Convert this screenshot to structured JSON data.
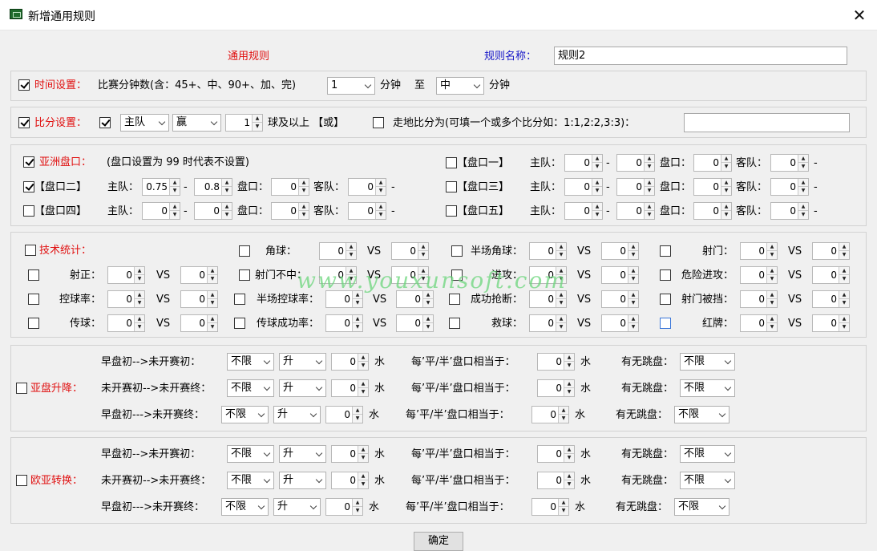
{
  "window": {
    "title": "新增通用规则",
    "close_glyph": "✕"
  },
  "header": {
    "section_label": "通用规则",
    "rule_name_label": "规则名称：",
    "rule_name_value": "规则2"
  },
  "time": {
    "label": "时间设置：",
    "desc": "比赛分钟数(含：45+、中、90+、加、完)",
    "from_value": "1",
    "from_unit": "分钟",
    "to_label": "至",
    "to_value": "中",
    "to_unit": "分钟"
  },
  "score": {
    "label": "比分设置：",
    "team": "主队",
    "result": "赢",
    "goals": "1",
    "goals_suffix": "球及以上 【或】",
    "alt_label": "走地比分为(可填一个或多个比分如：1:1,2:2,3:3)："
  },
  "handicap": {
    "label": "亚洲盘口：",
    "note": "(盘口设置为 99 时代表不设置)",
    "home": "主队：",
    "line": "盘口：",
    "away": "客队：",
    "dash": "-",
    "rows": [
      {
        "name": "【盘口一】",
        "home_from": "0",
        "home_to": "0",
        "line": "0",
        "away_from": "0"
      },
      {
        "name": "【盘口二】",
        "home_from": "0.75",
        "home_to": "0.8",
        "line": "0",
        "away_from": "0"
      },
      {
        "name": "【盘口三】",
        "home_from": "0",
        "home_to": "0",
        "line": "0",
        "away_from": "0"
      },
      {
        "name": "【盘口四】",
        "home_from": "0",
        "home_to": "0",
        "line": "0",
        "away_from": "0"
      },
      {
        "name": "【盘口五】",
        "home_from": "0",
        "home_to": "0",
        "line": "0",
        "away_from": "0"
      }
    ]
  },
  "tech": {
    "label": "技术统计：",
    "vs": "VS",
    "items": [
      {
        "name": "角球：",
        "a": "0",
        "b": "0"
      },
      {
        "name": "半场角球：",
        "a": "0",
        "b": "0"
      },
      {
        "name": "射门：",
        "a": "0",
        "b": "0"
      },
      {
        "name": "射正：",
        "a": "0",
        "b": "0"
      },
      {
        "name": "射门不中：",
        "a": "0",
        "b": "0"
      },
      {
        "name": "进攻：",
        "a": "0",
        "b": "0"
      },
      {
        "name": "危险进攻：",
        "a": "0",
        "b": "0"
      },
      {
        "name": "控球率：",
        "a": "0",
        "b": "0"
      },
      {
        "name": "半场控球率：",
        "a": "0",
        "b": "0"
      },
      {
        "name": "成功抢断：",
        "a": "0",
        "b": "0"
      },
      {
        "name": "射门被挡：",
        "a": "0",
        "b": "0"
      },
      {
        "name": "传球：",
        "a": "0",
        "b": "0"
      },
      {
        "name": "传球成功率：",
        "a": "0",
        "b": "0"
      },
      {
        "name": "救球：",
        "a": "0",
        "b": "0"
      },
      {
        "name": "红牌：",
        "a": "0",
        "b": "0"
      }
    ]
  },
  "asian_move": {
    "label": "亚盘升降：",
    "rows": [
      {
        "label": "早盘初-->未开赛初：",
        "sel1": "不限",
        "sel2": "升",
        "water": "0",
        "water_unit": "水",
        "per_label": "每’平/半’盘口相当于：",
        "per": "0",
        "per_unit": "水",
        "jump_label": "有无跳盘：",
        "jump": "不限"
      },
      {
        "label": "未开赛初-->未开赛终：",
        "sel1": "不限",
        "sel2": "升",
        "water": "0",
        "water_unit": "水",
        "per_label": "每’平/半’盘口相当于：",
        "per": "0",
        "per_unit": "水",
        "jump_label": "有无跳盘：",
        "jump": "不限"
      },
      {
        "label": "早盘初--->未开赛终：",
        "sel1": "不限",
        "sel2": "升",
        "water": "0",
        "water_unit": "水",
        "per_label": "每’平/半’盘口相当于：",
        "per": "0",
        "per_unit": "水",
        "jump_label": "有无跳盘：",
        "jump": "不限"
      }
    ]
  },
  "euro_conv": {
    "label": "欧亚转换：",
    "rows": [
      {
        "label": "早盘初-->未开赛初：",
        "sel1": "不限",
        "sel2": "升",
        "water": "0",
        "water_unit": "水",
        "per_label": "每’平/半’盘口相当于：",
        "per": "0",
        "per_unit": "水",
        "jump_label": "有无跳盘：",
        "jump": "不限"
      },
      {
        "label": "未开赛初-->未开赛终：",
        "sel1": "不限",
        "sel2": "升",
        "water": "0",
        "water_unit": "水",
        "per_label": "每’平/半’盘口相当于：",
        "per": "0",
        "per_unit": "水",
        "jump_label": "有无跳盘：",
        "jump": "不限"
      },
      {
        "label": "早盘初--->未开赛终：",
        "sel1": "不限",
        "sel2": "升",
        "water": "0",
        "water_unit": "水",
        "per_label": "每’平/半’盘口相当于：",
        "per": "0",
        "per_unit": "水",
        "jump_label": "有无跳盘：",
        "jump": "不限"
      }
    ]
  },
  "watermark": "www.youxunsoft.com",
  "ok_button": "确定",
  "colors": {
    "label_red": "#e01010",
    "label_blue": "#1616c8",
    "watermark": "#6cd67c"
  }
}
